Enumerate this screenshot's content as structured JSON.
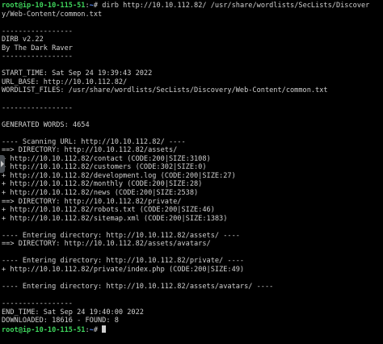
{
  "prompt": {
    "user_host": "root@ip-10-10-115-51",
    "separator": ":",
    "path": "~",
    "symbol": "# "
  },
  "command_line_1": "dirb http://10.10.112.82/ /usr/share/wordlists/SecLists/Discover",
  "command_line_2": "y/Web-Content/common.txt",
  "output": [
    "",
    "-----------------",
    "DIRB v2.22",
    "By The Dark Raver",
    "-----------------",
    "",
    "START_TIME: Sat Sep 24 19:39:43 2022",
    "URL_BASE: http://10.10.112.82/",
    "WORDLIST_FILES: /usr/share/wordlists/SecLists/Discovery/Web-Content/common.txt",
    "",
    "-----------------",
    "",
    "GENERATED WORDS: 4654",
    "",
    "---- Scanning URL: http://10.10.112.82/ ----",
    "==> DIRECTORY: http://10.10.112.82/assets/",
    "+ http://10.10.112.82/contact (CODE:200|SIZE:3108)",
    "+ http://10.10.112.82/customers (CODE:302|SIZE:0)",
    "+ http://10.10.112.82/development.log (CODE:200|SIZE:27)",
    "+ http://10.10.112.82/monthly (CODE:200|SIZE:28)",
    "+ http://10.10.112.82/news (CODE:200|SIZE:2538)",
    "==> DIRECTORY: http://10.10.112.82/private/",
    "+ http://10.10.112.82/robots.txt (CODE:200|SIZE:46)",
    "+ http://10.10.112.82/sitemap.xml (CODE:200|SIZE:1383)",
    "",
    "---- Entering directory: http://10.10.112.82/assets/ ----",
    "==> DIRECTORY: http://10.10.112.82/assets/avatars/",
    "",
    "---- Entering directory: http://10.10.112.82/private/ ----",
    "+ http://10.10.112.82/private/index.php (CODE:200|SIZE:49)",
    "",
    "---- Entering directory: http://10.10.112.82/assets/avatars/ ----",
    "",
    "-----------------",
    "END_TIME: Sat Sep 24 19:40:00 2022",
    "DOWNLOADED: 18616 - FOUND: 8"
  ],
  "colors": {
    "background": "#000000",
    "text": "#d0d0d0",
    "prompt_user": "#3fd45c",
    "prompt_path": "#5b8fff"
  },
  "icons": {
    "side_handle": "chevron-right-icon"
  }
}
